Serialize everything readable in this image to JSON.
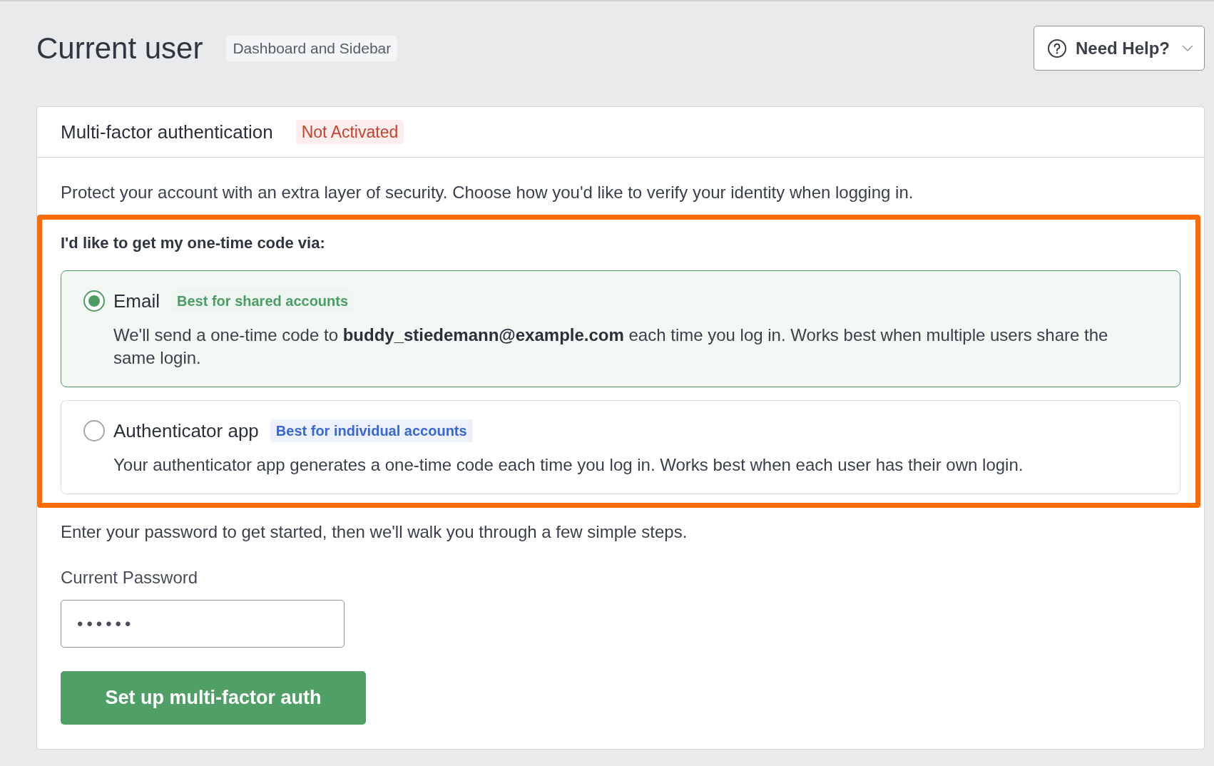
{
  "header": {
    "title": "Current user",
    "context_badge": "Dashboard and Sidebar",
    "help_button": "Need Help?"
  },
  "mfa_card": {
    "title": "Multi-factor authentication",
    "status_badge": "Not Activated",
    "intro": "Protect your account with an extra layer of security. Choose how you'd like to verify your identity when logging in.",
    "method_group": {
      "legend": "I'd like to get my one-time code via:",
      "options": [
        {
          "label": "Email",
          "tag": "Best for shared accounts",
          "color": "#4a9d63",
          "description": "We'll send a one-time code to **buddy_stiedemann@example.com** each time you log in. Works best when multiple users share the same login.",
          "selected": true
        },
        {
          "label": "Authenticator app",
          "tag": "Best for individual accounts",
          "color": "#3a67d6",
          "description": "Your authenticator app generates a one-time code each time you log in. Works best when each user has their own login.",
          "selected": false
        }
      ]
    },
    "instructions": "Enter your password to get started, then we'll walk you through a few simple steps.",
    "password_field": {
      "label": "Current Password",
      "value": "••••••"
    },
    "submit_button": "Set up multi-factor auth"
  }
}
